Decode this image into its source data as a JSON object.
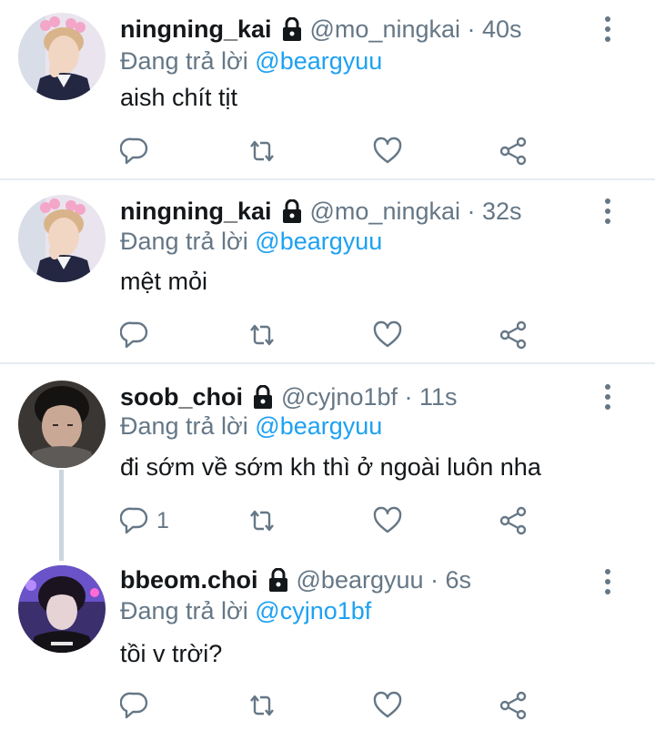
{
  "reply_prefix": "Đang trả lời",
  "tweets": [
    {
      "name": "ningning_kai",
      "meta": "@mo_ningkai · 40s",
      "reply_to": "@beargyuu",
      "text": "aish chít tịt",
      "reply_count": ""
    },
    {
      "name": "ningning_kai",
      "meta": "@mo_ningkai · 32s",
      "reply_to": "@beargyuu",
      "text": "mệt mỏi",
      "reply_count": ""
    },
    {
      "name": "soob_choi",
      "meta": "@cyjno1bf · 11s",
      "reply_to": "@beargyuu",
      "text": "đi sớm về sớm kh thì ở ngoài luôn nha",
      "reply_count": "1"
    },
    {
      "name": "bbeom.choi",
      "meta": "@beargyuu · 6s",
      "reply_to": "@cyjno1bf",
      "text": "tồi v trời?",
      "reply_count": ""
    }
  ],
  "colors": {
    "link": "#1da1f2",
    "secondary": "#657786",
    "divider": "#e6ecf0",
    "icon": "#657786"
  },
  "icons": [
    "avatar",
    "lock-icon",
    "more-options-icon",
    "reply-icon",
    "retweet-icon",
    "like-icon",
    "share-icon"
  ]
}
